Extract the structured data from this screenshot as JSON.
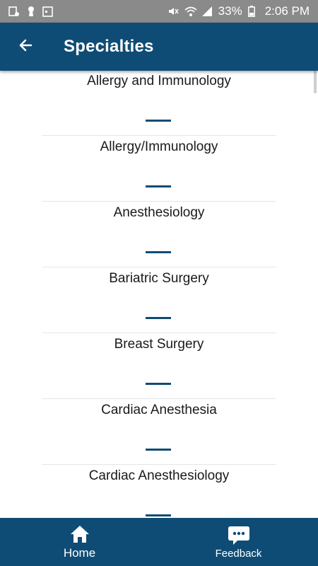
{
  "status_bar": {
    "battery": "33%",
    "time": "2:06 PM",
    "icons_left": [
      "notification-icon",
      "keyhole-icon",
      "calendar-icon"
    ],
    "icons_right": [
      "mute-icon",
      "wifi-icon",
      "signal-icon",
      "battery-icon"
    ]
  },
  "header": {
    "title": "Specialties",
    "back_icon": "arrow-left-icon",
    "background": "#0f4c75"
  },
  "specialties": [
    {
      "label": "Allergy and Immunology"
    },
    {
      "label": "Allergy/Immunology"
    },
    {
      "label": "Anesthesiology"
    },
    {
      "label": "Bariatric Surgery"
    },
    {
      "label": "Breast Surgery"
    },
    {
      "label": "Cardiac Anesthesia"
    },
    {
      "label": "Cardiac Anesthesiology"
    }
  ],
  "bottom_nav": {
    "home": {
      "label": "Home",
      "icon": "home-icon"
    },
    "feedback": {
      "label": "Feedback",
      "icon": "chat-bubble-icon"
    }
  }
}
